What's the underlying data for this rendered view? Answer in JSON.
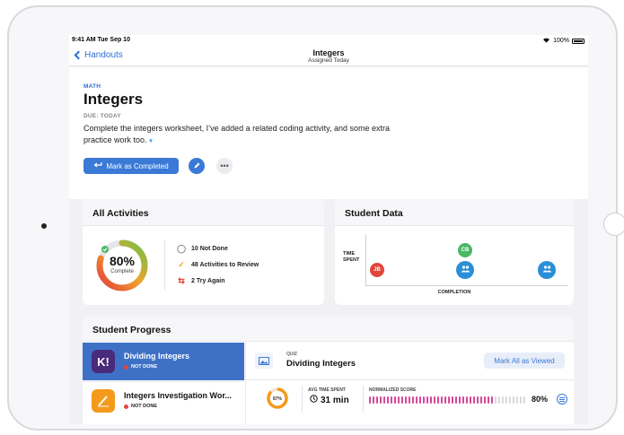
{
  "status_bar": {
    "time_date": "9:41 AM  Tue Sep 10",
    "battery": "100%"
  },
  "nav": {
    "back_label": "Handouts",
    "title": "Integers",
    "subtitle": "Assigned Today"
  },
  "assignment": {
    "subject": "MATH",
    "title": "Integers",
    "due": "DUE: TODAY",
    "description": "Complete the integers worksheet, I’ve added a related coding activity, and some extra practice work too.",
    "mark_completed_label": "Mark as Completed",
    "more_label": "•••"
  },
  "all_activities": {
    "heading": "All Activities",
    "percent": "80%",
    "percent_label": "Complete",
    "completion_fraction": 0.8,
    "stats": [
      {
        "icon": "not-done-icon",
        "label": "10 Not Done"
      },
      {
        "icon": "checkmark-icon",
        "label": "48 Activities to Review"
      },
      {
        "icon": "retry-icon",
        "label": "2 Try Again"
      }
    ]
  },
  "student_data": {
    "heading": "Student Data",
    "y_label_line1": "TIME",
    "y_label_line2": "SPENT",
    "x_label": "COMPLETION",
    "points": [
      {
        "label": "JB",
        "color": "#e0473b"
      },
      {
        "label": "CB",
        "color": "#4bb864"
      },
      {
        "label": "",
        "color": "#2a8fd6",
        "icon": "group-icon"
      },
      {
        "label": "",
        "color": "#2a8fd6",
        "icon": "group-icon"
      }
    ]
  },
  "student_progress": {
    "heading": "Student Progress",
    "activities": [
      {
        "title": "Dividing Integers",
        "status": "NOT DONE",
        "app_icon": "K!",
        "app_color": "#4a2a7a"
      },
      {
        "title": "Integers Investigation Wor...",
        "status": "NOT DONE",
        "app_color": "#f39a1c"
      }
    ],
    "detail": {
      "type_label": "QUIZ",
      "title": "Dividing Integers",
      "mark_viewed_label": "Mark All as Viewed",
      "ring_percent": "87%",
      "ring_fraction": 0.87,
      "avg_time_label": "AVG TIME SPENT",
      "avg_time_value": "31 min",
      "score_label": "NORMALIZED SCORE",
      "score_value": "80%",
      "score_fraction": 0.8
    }
  }
}
